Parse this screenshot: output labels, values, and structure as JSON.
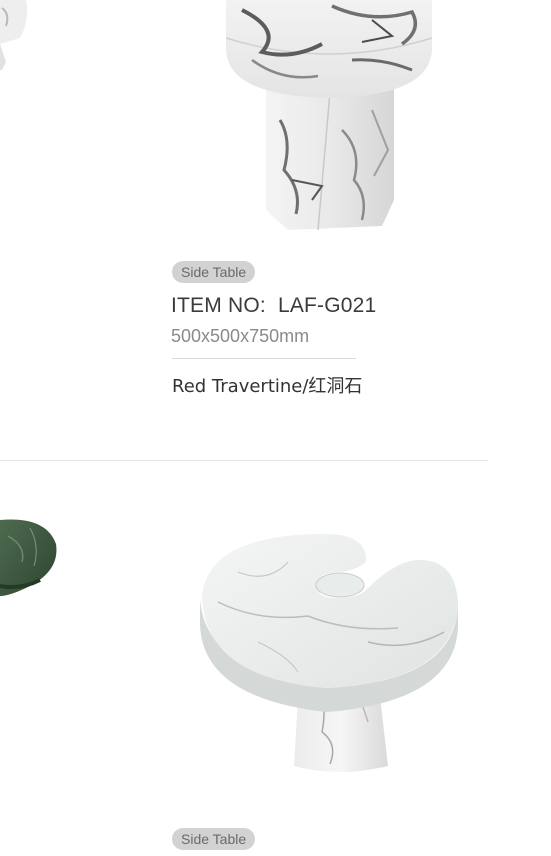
{
  "products": [
    {
      "tag": "Side Table",
      "item_label": "ITEM NO:",
      "item_code": "LAF-G021",
      "dimensions": "500x500x750mm",
      "material": "Red Travertine/红洞石"
    },
    {
      "tag": "Side Table"
    }
  ],
  "colors": {
    "tag_bg": "#d2d2d2",
    "text_dark": "#3b3b3b",
    "text_muted": "#8a8a8a",
    "divider": "#e6e6e6"
  }
}
